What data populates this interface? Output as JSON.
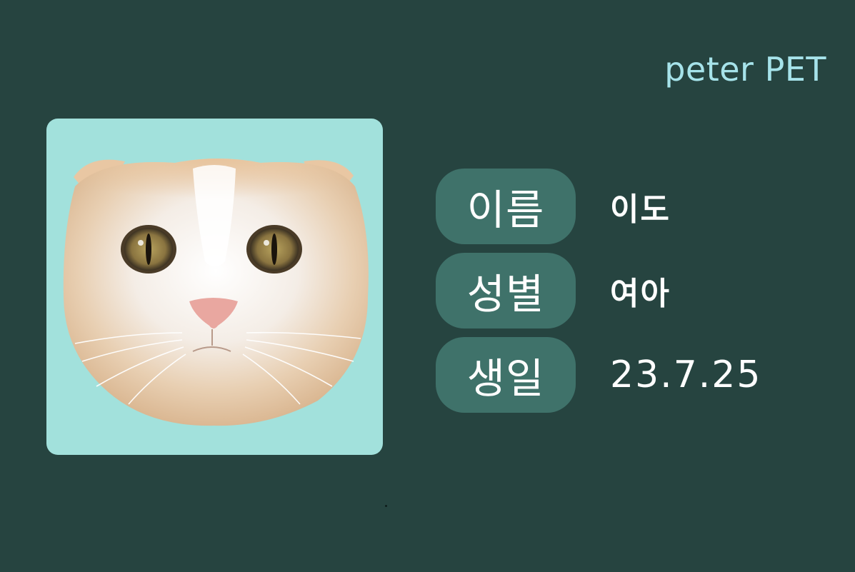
{
  "brand": {
    "title": "peter PET"
  },
  "photo": {
    "icon": "cat-face-photo",
    "background_color": "#a2e1dc"
  },
  "info": {
    "rows": [
      {
        "label": "이름",
        "value": "이도"
      },
      {
        "label": "성별",
        "value": "여아"
      },
      {
        "label": "생일",
        "value": "23.7.25"
      }
    ]
  },
  "colors": {
    "background": "#264440",
    "pill": "#3f726a",
    "brand_text": "#a6e3ea",
    "text": "#ffffff"
  }
}
